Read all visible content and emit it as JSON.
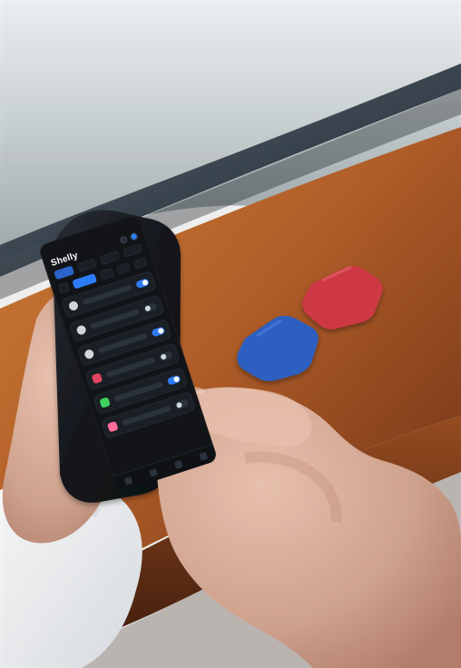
{
  "scene": {
    "description_tag": "photo-scene",
    "colors": {
      "window_top": "#dfe6ea",
      "window_mid": "#a9b4b6",
      "window_frame": "#2f3a44",
      "sill_wood_top": "#c06a2c",
      "sill_wood_mid": "#9b4f21",
      "sill_wood_dark": "#5a2a12",
      "shirt_white": "#f4f5f7",
      "skin": "#d7aa94",
      "skin_shadow": "#b98270",
      "device_blue": "#2f64c7",
      "device_red": "#d63a46",
      "phone_case": "#1a1d22"
    },
    "icons": [
      "phone-screen",
      "blue-module",
      "red-module"
    ]
  },
  "phone": {
    "status": {
      "time": "",
      "signal": ""
    },
    "app": {
      "brand": "Shelly"
    }
  }
}
